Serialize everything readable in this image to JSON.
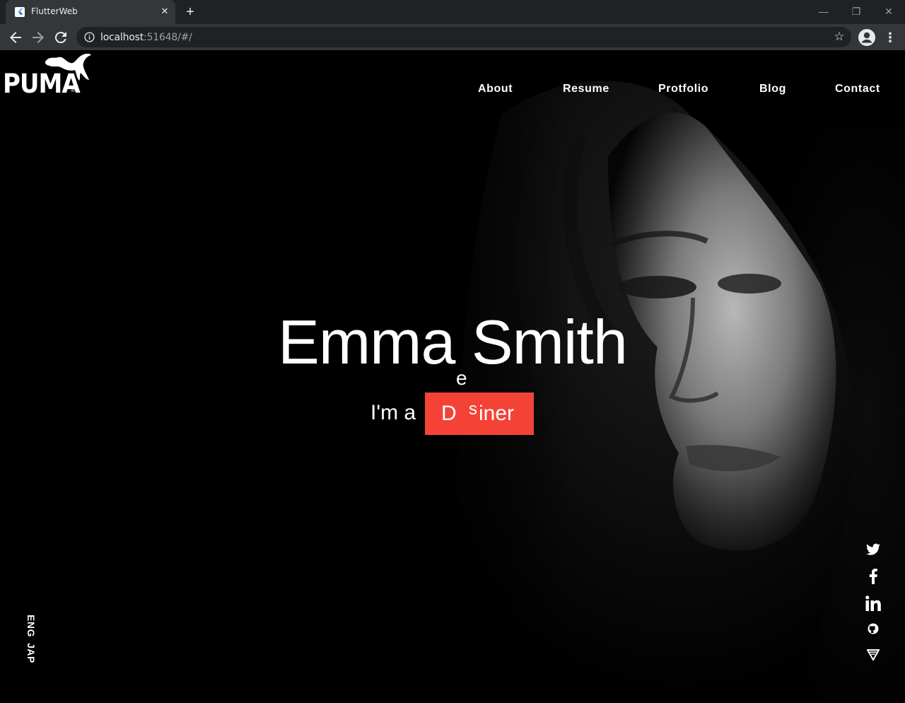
{
  "browser": {
    "tab_title": "FlutterWeb",
    "url_host": "localhost",
    "url_rest": ":51648/#/"
  },
  "logo": {
    "text": "PUMA",
    "reg": "®"
  },
  "nav": {
    "items": [
      {
        "label": "About"
      },
      {
        "label": "Resume"
      },
      {
        "label": "Protfolio"
      },
      {
        "label": "Blog"
      },
      {
        "label": "Contact"
      }
    ]
  },
  "hero": {
    "name": "Emma Smith",
    "prefix": "I'm a",
    "role_d": "D",
    "role_e": "e",
    "role_s": "s",
    "role_iner": "iner",
    "role_color": "#f44336"
  },
  "languages": [
    "ENG",
    "JAP"
  ],
  "social_icons": [
    "twitter-icon",
    "facebook-icon",
    "linkedin-icon",
    "github-icon",
    "vimeo-icon"
  ]
}
